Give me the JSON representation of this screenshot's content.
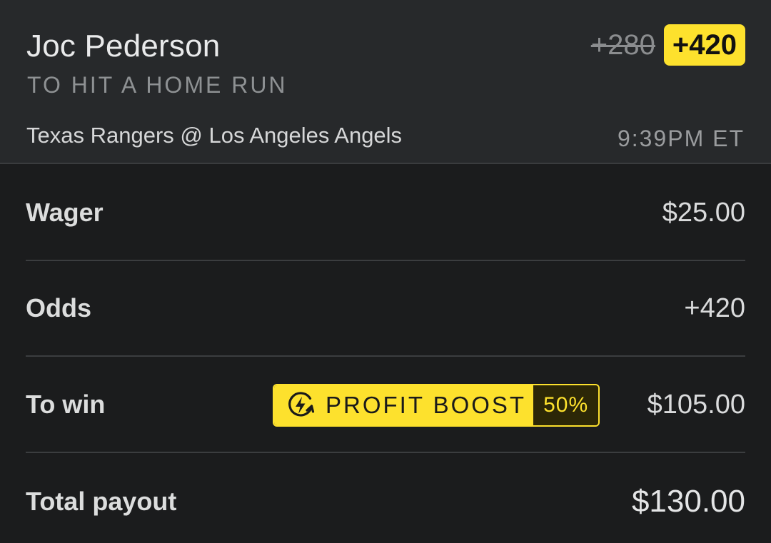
{
  "bet": {
    "player": "Joc Pederson",
    "market": "TO HIT A HOME RUN",
    "matchup": "Texas Rangers @ Los Angeles Angels",
    "time": "9:39PM ET",
    "original_odds": "+280",
    "boosted_odds": "+420"
  },
  "rows": {
    "wager": {
      "label": "Wager",
      "value": "$25.00"
    },
    "odds": {
      "label": "Odds",
      "value": "+420"
    },
    "to_win": {
      "label": "To win",
      "value": "$105.00"
    },
    "total_payout": {
      "label": "Total payout",
      "value": "$130.00"
    }
  },
  "boost": {
    "icon": "lightning-boost-icon",
    "label": "PROFIT BOOST",
    "percent": "50%"
  },
  "colors": {
    "accent": "#fde12d",
    "header_bg": "#27292b",
    "body_bg": "#1b1c1d"
  }
}
